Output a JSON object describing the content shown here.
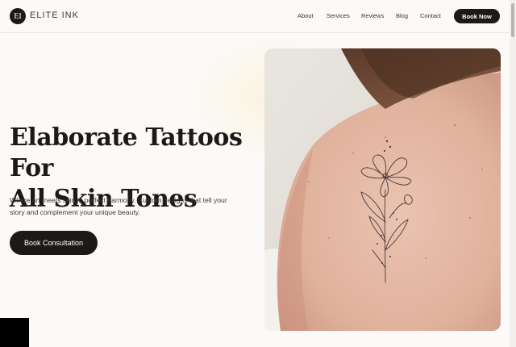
{
  "brand": {
    "mark": "EI",
    "name": "ELITE INK"
  },
  "nav": {
    "items": [
      {
        "label": "About"
      },
      {
        "label": "Services"
      },
      {
        "label": "Reviews"
      },
      {
        "label": "Blog"
      },
      {
        "label": "Contact"
      }
    ],
    "cta_label": "Book Now"
  },
  "hero": {
    "title_line1": "Elaborate Tattoos For",
    "title_line2": "All Skin Tones",
    "subtitle_line1": "Where art meets skin in perfect harmony. Custom designs that tell your",
    "subtitle_line2": "story and complement your unique beauty.",
    "cta_label": "Book Consultation",
    "image_icon": "floral-tattoo-on-shoulder-image"
  },
  "colors": {
    "background": "#fbfaf8",
    "primary": "#1c1a18",
    "skin": "#e3b8a5"
  }
}
